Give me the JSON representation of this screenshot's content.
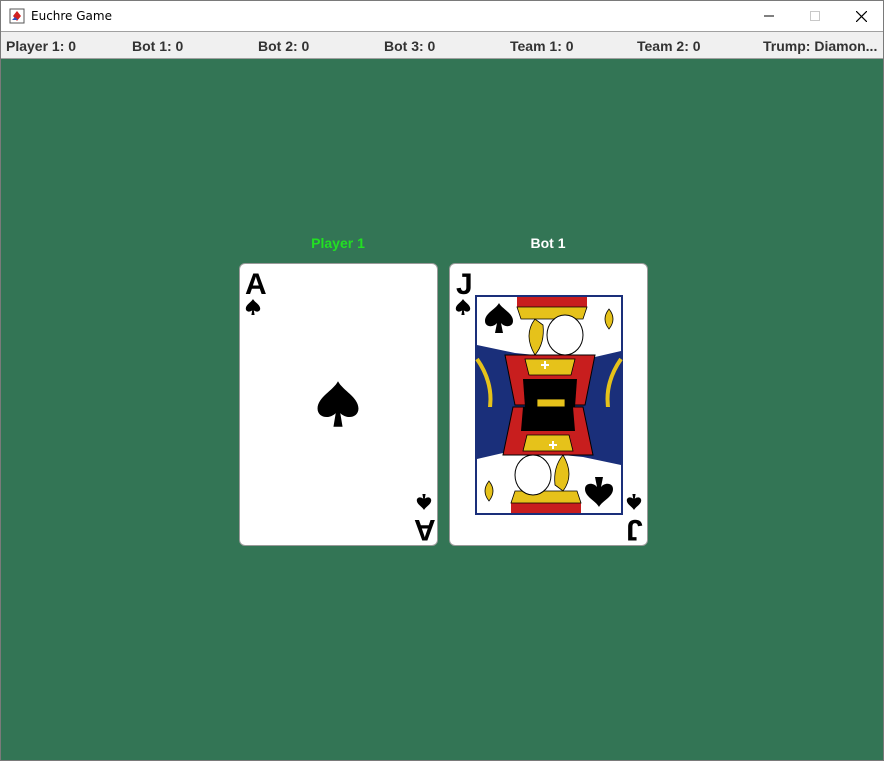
{
  "window": {
    "title": "Euchre Game"
  },
  "scores": [
    {
      "label": "Player 1: 0"
    },
    {
      "label": "Bot 1: 0"
    },
    {
      "label": "Bot 2: 0"
    },
    {
      "label": "Bot 3: 0"
    },
    {
      "label": "Team 1: 0"
    },
    {
      "label": "Team 2: 0"
    },
    {
      "label": "Trump: Diamon..."
    }
  ],
  "plays": [
    {
      "player": "Player 1",
      "label_color": "#22e022",
      "card": {
        "rank": "A",
        "suit": "spades"
      }
    },
    {
      "player": "Bot 1",
      "label_color": "#ffffff",
      "card": {
        "rank": "J",
        "suit": "spades"
      }
    }
  ],
  "colors": {
    "table": "#337555",
    "scorebar": "#f0f0f0"
  }
}
